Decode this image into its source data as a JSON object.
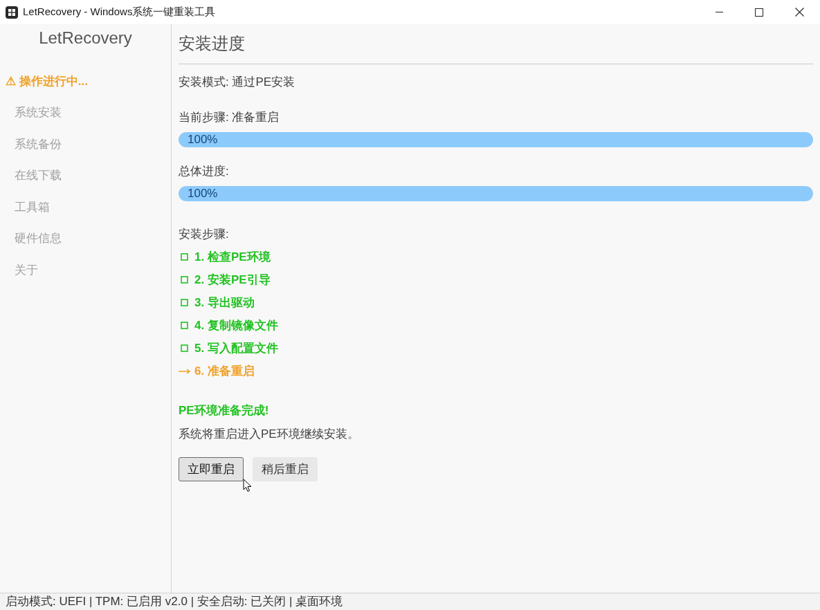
{
  "window": {
    "title": "LetRecovery - Windows系统一键重装工具"
  },
  "sidebar": {
    "title": "LetRecovery",
    "warning": "⚠ 操作进行中...",
    "items": [
      {
        "label": "系统安装",
        "disabled": true
      },
      {
        "label": "系统备份",
        "disabled": true
      },
      {
        "label": "在线下载",
        "disabled": true
      },
      {
        "label": "工具箱",
        "disabled": true
      },
      {
        "label": "硬件信息",
        "disabled": true
      },
      {
        "label": "关于",
        "disabled": true
      }
    ]
  },
  "main": {
    "heading": "安装进度",
    "mode": "安装模式: 通过PE安装",
    "current_step": {
      "label": "当前步骤: 准备重启",
      "progress": {
        "level": 1,
        "reading": "100%"
      }
    },
    "overall": {
      "label": "总体进度:",
      "progress": {
        "level": 1,
        "reading": "100%"
      }
    },
    "steps_label": "安装步骤:",
    "steps": [
      {
        "label": "1. 检查PE环境",
        "kind": "done"
      },
      {
        "label": "2. 安装PE引导",
        "kind": "done"
      },
      {
        "label": "3. 导出驱动",
        "kind": "done"
      },
      {
        "label": "4. 复制镜像文件",
        "kind": "done"
      },
      {
        "label": "5. 写入配置文件",
        "kind": "done"
      },
      {
        "label": "6. 准备重启",
        "kind": "current"
      }
    ],
    "message": {
      "title": "PE环境准备完成!",
      "text": "系统将重启进入PE环境继续安装。"
    },
    "buttons": [
      {
        "label": "立即重启",
        "hovered": true
      },
      {
        "label": "稍后重启",
        "hovered": false
      }
    ]
  },
  "status_bar": "启动模式: UEFI | TPM: 已启用 v2.0 | 安全启动: 已关闭 | 桌面环境"
}
